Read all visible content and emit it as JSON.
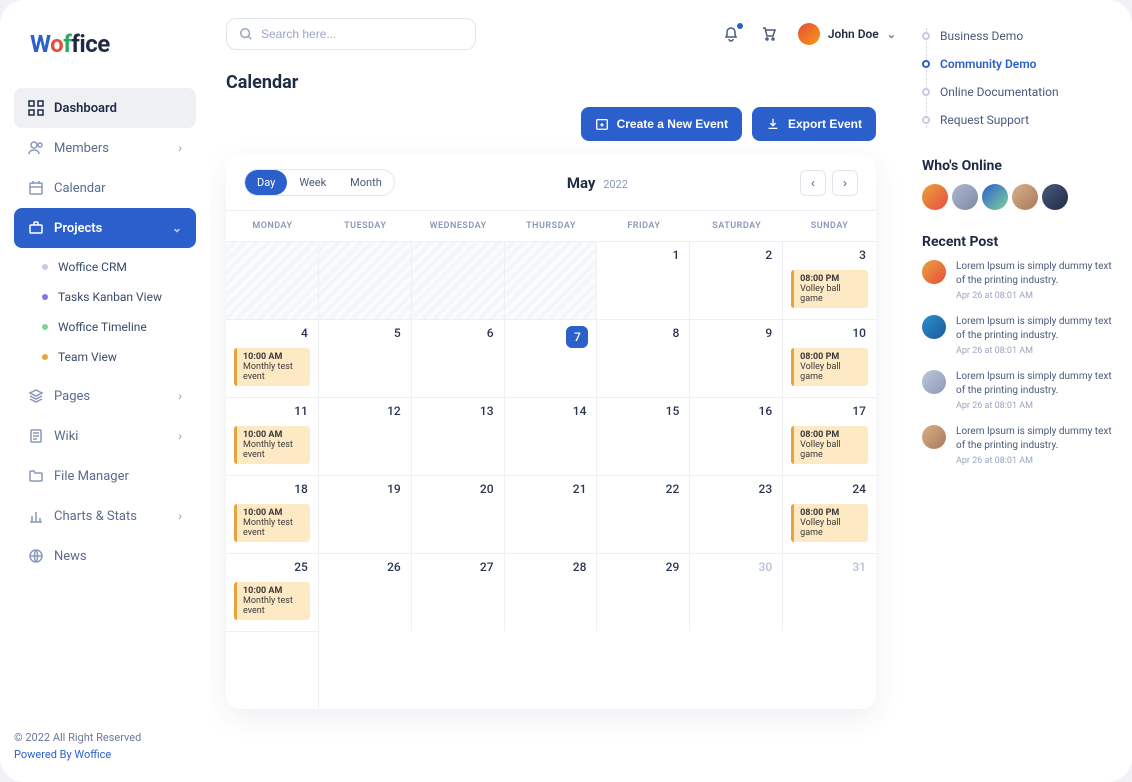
{
  "logo": "Woffice",
  "search": {
    "placeholder": "Search here..."
  },
  "user": {
    "name": "John Doe"
  },
  "page_title": "Calendar",
  "nav": {
    "dashboard": "Dashboard",
    "members": "Members",
    "calendar": "Calendar",
    "projects": "Projects",
    "pages": "Pages",
    "wiki": "Wiki",
    "file_manager": "File Manager",
    "charts": "Charts & Stats",
    "news": "News"
  },
  "sub_projects": [
    {
      "label": "Woffice CRM",
      "dot": "#c5cde0"
    },
    {
      "label": "Tasks Kanban View",
      "dot": "#8e6fe8"
    },
    {
      "label": "Woffice Timeline",
      "dot": "#7fd19a"
    },
    {
      "label": "Team View",
      "dot": "#e8a33d"
    }
  ],
  "actions": {
    "create": "Create a New Event",
    "export": "Export Event"
  },
  "view_tabs": {
    "day": "Day",
    "week": "Week",
    "month": "Month"
  },
  "cal": {
    "month": "May",
    "year": "2022"
  },
  "weekdays": [
    "MONDAY",
    "TUESDAY",
    "WEDNESDAY",
    "THURSDAY",
    "FRIDAY",
    "SATURDAY",
    "SUNDAY"
  ],
  "cells": [
    {
      "d": "",
      "disabled": true
    },
    {
      "d": "",
      "disabled": true
    },
    {
      "d": "",
      "disabled": true
    },
    {
      "d": "",
      "disabled": true
    },
    {
      "d": "1"
    },
    {
      "d": "2"
    },
    {
      "d": "3",
      "ev": {
        "time": "08:00 PM",
        "title": "Volley ball game"
      }
    },
    {
      "d": "4",
      "ev": {
        "time": "10:00 AM",
        "title": "Monthly test event"
      }
    },
    {
      "d": "5"
    },
    {
      "d": "6"
    },
    {
      "d": "7",
      "selected": true
    },
    {
      "d": "8"
    },
    {
      "d": "9"
    },
    {
      "d": "10",
      "ev": {
        "time": "08:00 PM",
        "title": "Volley ball game"
      }
    },
    {
      "d": "11",
      "ev": {
        "time": "10:00 AM",
        "title": "Monthly test event"
      }
    },
    {
      "d": "12"
    },
    {
      "d": "13"
    },
    {
      "d": "14"
    },
    {
      "d": "15"
    },
    {
      "d": "16"
    },
    {
      "d": "17",
      "ev": {
        "time": "08:00 PM",
        "title": "Volley ball game"
      }
    },
    {
      "d": "18",
      "ev": {
        "time": "10:00 AM",
        "title": "Monthly test event"
      }
    },
    {
      "d": "19"
    },
    {
      "d": "20"
    },
    {
      "d": "21"
    },
    {
      "d": "22"
    },
    {
      "d": "23"
    },
    {
      "d": "24",
      "ev": {
        "time": "08:00 PM",
        "title": "Volley ball game"
      }
    },
    {
      "d": "25",
      "ev": {
        "time": "10:00 AM",
        "title": "Monthly test event"
      }
    },
    {
      "d": "26"
    },
    {
      "d": "27"
    },
    {
      "d": "28"
    },
    {
      "d": "29"
    },
    {
      "d": "30",
      "faded": true
    },
    {
      "d": "31",
      "faded": true
    },
    {
      "d": "",
      "hidden": true
    }
  ],
  "quick_links": [
    {
      "label": "Business Demo"
    },
    {
      "label": "Community Demo",
      "active": true
    },
    {
      "label": "Online Documentation"
    },
    {
      "label": "Request Support"
    }
  ],
  "whos_online_title": "Who's Online",
  "online_avatars": [
    "linear-gradient(135deg,#e8a33d,#e84c3d)",
    "linear-gradient(135deg,#b0b8cc,#7a88a8)",
    "linear-gradient(135deg,#2b5fcc,#7fd19a)",
    "linear-gradient(135deg,#d8b08a,#a87a5a)",
    "linear-gradient(135deg,#4a5a7a,#1f2b45)"
  ],
  "recent_title": "Recent Post",
  "posts": [
    {
      "text": "Lorem Ipsum is simply dummy text of the printing industry.",
      "meta": "Apr 26 at 08:01 AM",
      "bg": "linear-gradient(135deg,#e8a33d,#e84c3d)"
    },
    {
      "text": "Lorem Ipsum is simply dummy text of the printing industry.",
      "meta": "Apr 26 at 08:01 AM",
      "bg": "linear-gradient(135deg,#2b8fcc,#1a5a9a)"
    },
    {
      "text": "Lorem Ipsum is simply dummy text of the printing industry.",
      "meta": "Apr 26 at 08:01 AM",
      "bg": "linear-gradient(135deg,#c0c8d8,#8a98b8)"
    },
    {
      "text": "Lorem Ipsum is simply dummy text of the printing industry.",
      "meta": "Apr 26 at 08:01 AM",
      "bg": "linear-gradient(135deg,#d8b08a,#a87a5a)"
    }
  ],
  "footer": {
    "copyright": "© 2022 All Right Reserved",
    "powered": "Powered By Woffice"
  }
}
